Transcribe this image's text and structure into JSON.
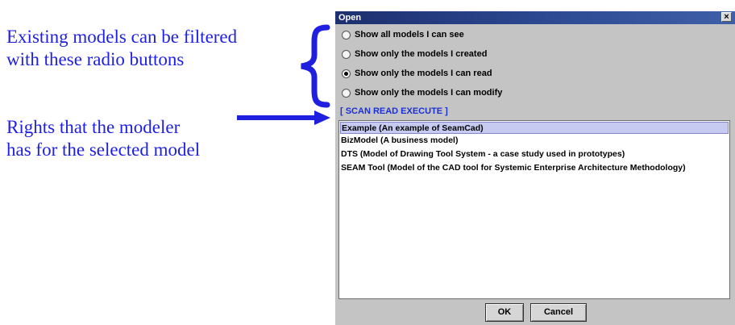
{
  "annotations": {
    "filter_line1": "Existing models can be filtered",
    "filter_line2": "with these radio buttons",
    "rights_line1": "Rights that the modeler",
    "rights_line2": "has for the selected model"
  },
  "dialog": {
    "title": "Open",
    "close_label": "×",
    "radio_options": [
      {
        "label": "Show all models I can see",
        "checked": false
      },
      {
        "label": "Show only the models I created",
        "checked": false
      },
      {
        "label": "Show only the models I can read",
        "checked": true
      },
      {
        "label": "Show only the models I can modify",
        "checked": false
      }
    ],
    "rights_text": "[ SCAN READ EXECUTE ]",
    "models": [
      {
        "label": "Example (An example of SeamCad)",
        "selected": true
      },
      {
        "label": "BizModel (A business model)",
        "selected": false
      },
      {
        "label": "DTS (Model of Drawing Tool System - a case study used in prototypes)",
        "selected": false
      },
      {
        "label": "SEAM Tool (Model of the CAD tool for Systemic Enterprise Architecture Methodology)",
        "selected": false
      }
    ],
    "ok_label": "OK",
    "cancel_label": "Cancel"
  },
  "colors": {
    "annotation_blue": "#1f1fe0",
    "titlebar": "#1d2f6e",
    "selection": "#c7cbf2"
  }
}
